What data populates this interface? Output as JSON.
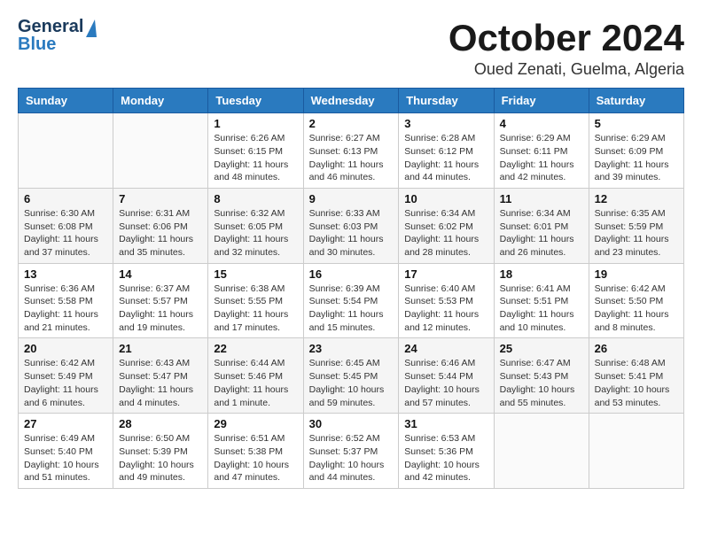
{
  "header": {
    "logo_top": "General",
    "logo_bottom": "Blue",
    "month": "October 2024",
    "location": "Oued Zenati, Guelma, Algeria"
  },
  "days_of_week": [
    "Sunday",
    "Monday",
    "Tuesday",
    "Wednesday",
    "Thursday",
    "Friday",
    "Saturday"
  ],
  "weeks": [
    [
      {
        "day": "",
        "content": ""
      },
      {
        "day": "",
        "content": ""
      },
      {
        "day": "1",
        "content": "Sunrise: 6:26 AM\nSunset: 6:15 PM\nDaylight: 11 hours and 48 minutes."
      },
      {
        "day": "2",
        "content": "Sunrise: 6:27 AM\nSunset: 6:13 PM\nDaylight: 11 hours and 46 minutes."
      },
      {
        "day": "3",
        "content": "Sunrise: 6:28 AM\nSunset: 6:12 PM\nDaylight: 11 hours and 44 minutes."
      },
      {
        "day": "4",
        "content": "Sunrise: 6:29 AM\nSunset: 6:11 PM\nDaylight: 11 hours and 42 minutes."
      },
      {
        "day": "5",
        "content": "Sunrise: 6:29 AM\nSunset: 6:09 PM\nDaylight: 11 hours and 39 minutes."
      }
    ],
    [
      {
        "day": "6",
        "content": "Sunrise: 6:30 AM\nSunset: 6:08 PM\nDaylight: 11 hours and 37 minutes."
      },
      {
        "day": "7",
        "content": "Sunrise: 6:31 AM\nSunset: 6:06 PM\nDaylight: 11 hours and 35 minutes."
      },
      {
        "day": "8",
        "content": "Sunrise: 6:32 AM\nSunset: 6:05 PM\nDaylight: 11 hours and 32 minutes."
      },
      {
        "day": "9",
        "content": "Sunrise: 6:33 AM\nSunset: 6:03 PM\nDaylight: 11 hours and 30 minutes."
      },
      {
        "day": "10",
        "content": "Sunrise: 6:34 AM\nSunset: 6:02 PM\nDaylight: 11 hours and 28 minutes."
      },
      {
        "day": "11",
        "content": "Sunrise: 6:34 AM\nSunset: 6:01 PM\nDaylight: 11 hours and 26 minutes."
      },
      {
        "day": "12",
        "content": "Sunrise: 6:35 AM\nSunset: 5:59 PM\nDaylight: 11 hours and 23 minutes."
      }
    ],
    [
      {
        "day": "13",
        "content": "Sunrise: 6:36 AM\nSunset: 5:58 PM\nDaylight: 11 hours and 21 minutes."
      },
      {
        "day": "14",
        "content": "Sunrise: 6:37 AM\nSunset: 5:57 PM\nDaylight: 11 hours and 19 minutes."
      },
      {
        "day": "15",
        "content": "Sunrise: 6:38 AM\nSunset: 5:55 PM\nDaylight: 11 hours and 17 minutes."
      },
      {
        "day": "16",
        "content": "Sunrise: 6:39 AM\nSunset: 5:54 PM\nDaylight: 11 hours and 15 minutes."
      },
      {
        "day": "17",
        "content": "Sunrise: 6:40 AM\nSunset: 5:53 PM\nDaylight: 11 hours and 12 minutes."
      },
      {
        "day": "18",
        "content": "Sunrise: 6:41 AM\nSunset: 5:51 PM\nDaylight: 11 hours and 10 minutes."
      },
      {
        "day": "19",
        "content": "Sunrise: 6:42 AM\nSunset: 5:50 PM\nDaylight: 11 hours and 8 minutes."
      }
    ],
    [
      {
        "day": "20",
        "content": "Sunrise: 6:42 AM\nSunset: 5:49 PM\nDaylight: 11 hours and 6 minutes."
      },
      {
        "day": "21",
        "content": "Sunrise: 6:43 AM\nSunset: 5:47 PM\nDaylight: 11 hours and 4 minutes."
      },
      {
        "day": "22",
        "content": "Sunrise: 6:44 AM\nSunset: 5:46 PM\nDaylight: 11 hours and 1 minute."
      },
      {
        "day": "23",
        "content": "Sunrise: 6:45 AM\nSunset: 5:45 PM\nDaylight: 10 hours and 59 minutes."
      },
      {
        "day": "24",
        "content": "Sunrise: 6:46 AM\nSunset: 5:44 PM\nDaylight: 10 hours and 57 minutes."
      },
      {
        "day": "25",
        "content": "Sunrise: 6:47 AM\nSunset: 5:43 PM\nDaylight: 10 hours and 55 minutes."
      },
      {
        "day": "26",
        "content": "Sunrise: 6:48 AM\nSunset: 5:41 PM\nDaylight: 10 hours and 53 minutes."
      }
    ],
    [
      {
        "day": "27",
        "content": "Sunrise: 6:49 AM\nSunset: 5:40 PM\nDaylight: 10 hours and 51 minutes."
      },
      {
        "day": "28",
        "content": "Sunrise: 6:50 AM\nSunset: 5:39 PM\nDaylight: 10 hours and 49 minutes."
      },
      {
        "day": "29",
        "content": "Sunrise: 6:51 AM\nSunset: 5:38 PM\nDaylight: 10 hours and 47 minutes."
      },
      {
        "day": "30",
        "content": "Sunrise: 6:52 AM\nSunset: 5:37 PM\nDaylight: 10 hours and 44 minutes."
      },
      {
        "day": "31",
        "content": "Sunrise: 6:53 AM\nSunset: 5:36 PM\nDaylight: 10 hours and 42 minutes."
      },
      {
        "day": "",
        "content": ""
      },
      {
        "day": "",
        "content": ""
      }
    ]
  ]
}
